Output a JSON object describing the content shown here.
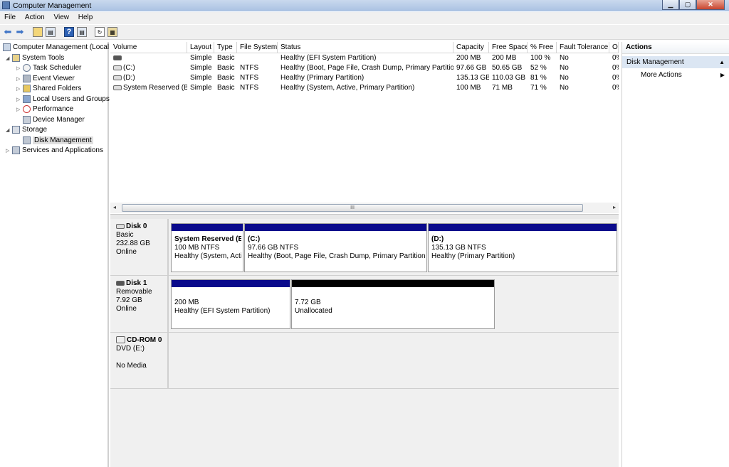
{
  "window": {
    "title": "Computer Management"
  },
  "menu": [
    "File",
    "Action",
    "View",
    "Help"
  ],
  "tree": {
    "root": "Computer Management (Local",
    "system_tools": "System Tools",
    "task_scheduler": "Task Scheduler",
    "event_viewer": "Event Viewer",
    "shared_folders": "Shared Folders",
    "local_users": "Local Users and Groups",
    "performance": "Performance",
    "device_manager": "Device Manager",
    "storage": "Storage",
    "disk_management": "Disk Management",
    "services": "Services and Applications"
  },
  "volumes": {
    "columns": [
      "Volume",
      "Layout",
      "Type",
      "File System",
      "Status",
      "Capacity",
      "Free Space",
      "% Free",
      "Fault Tolerance",
      "O"
    ],
    "rows": [
      {
        "volume": "",
        "layout": "Simple",
        "type": "Basic",
        "fs": "",
        "status": "Healthy (EFI System Partition)",
        "capacity": "200 MB",
        "free": "200 MB",
        "pct": "100 %",
        "fault": "No",
        "o": "0%"
      },
      {
        "volume": "(C:)",
        "layout": "Simple",
        "type": "Basic",
        "fs": "NTFS",
        "status": "Healthy (Boot, Page File, Crash Dump, Primary Partition)",
        "capacity": "97.66 GB",
        "free": "50.65 GB",
        "pct": "52 %",
        "fault": "No",
        "o": "0%"
      },
      {
        "volume": "(D:)",
        "layout": "Simple",
        "type": "Basic",
        "fs": "NTFS",
        "status": "Healthy (Primary Partition)",
        "capacity": "135.13 GB",
        "free": "110.03 GB",
        "pct": "81 %",
        "fault": "No",
        "o": "0%"
      },
      {
        "volume": "System Reserved (B:)",
        "layout": "Simple",
        "type": "Basic",
        "fs": "NTFS",
        "status": "Healthy (System, Active, Primary Partition)",
        "capacity": "100 MB",
        "free": "71 MB",
        "pct": "71 %",
        "fault": "No",
        "o": "0%"
      }
    ]
  },
  "scroll_marker": "III",
  "disks": {
    "disk0": {
      "name": "Disk 0",
      "type": "Basic",
      "size": "232.88 GB",
      "status": "Online",
      "parts": [
        {
          "name": "System Reserved (E",
          "size": "100 MB NTFS",
          "status": "Healthy (System, Acti"
        },
        {
          "name": "(C:)",
          "size": "97.66 GB NTFS",
          "status": "Healthy (Boot, Page File, Crash Dump, Primary Partition)"
        },
        {
          "name": "(D:)",
          "size": "135.13 GB NTFS",
          "status": "Healthy (Primary Partition)"
        }
      ]
    },
    "disk1": {
      "name": "Disk 1",
      "type": "Removable",
      "size": "7.92 GB",
      "status": "Online",
      "parts": [
        {
          "size": "200 MB",
          "status": "Healthy (EFI System Partition)"
        },
        {
          "size": "7.72 GB",
          "status": "Unallocated"
        }
      ]
    },
    "cdrom": {
      "name": "CD-ROM 0",
      "type": "DVD (E:)",
      "status": "No Media"
    }
  },
  "actions": {
    "title": "Actions",
    "section": "Disk Management",
    "more": "More Actions"
  },
  "colors": {
    "primary_bar": "#0a0a8c",
    "unallocated_bar": "#000000",
    "selection": "#dbe6f3"
  }
}
